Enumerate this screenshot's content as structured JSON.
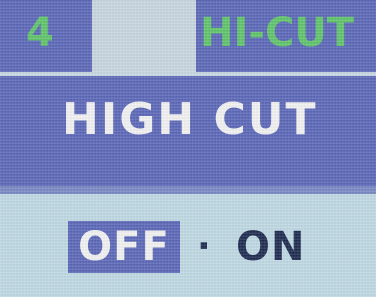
{
  "header": {
    "page_number": "4",
    "mode_title": "HI-CUT"
  },
  "title": "HIGH CUT",
  "options": {
    "off_label": "OFF",
    "separator": "·",
    "on_label": "ON",
    "selected": "OFF"
  },
  "colors": {
    "panel_blue": "#5b67b8",
    "background": "#bcd6e0",
    "header_text": "#5fc46a",
    "title_text": "#f2f2f2",
    "option_text": "#1d2a4f"
  }
}
